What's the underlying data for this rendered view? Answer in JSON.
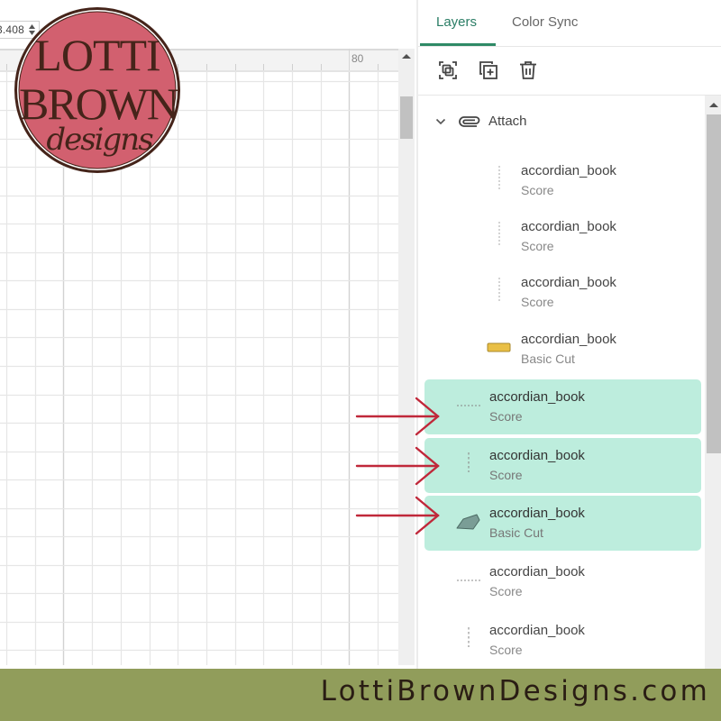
{
  "canvas": {
    "dimension_input": {
      "value": "3.408"
    },
    "ruler": {
      "label": "80"
    }
  },
  "logo": {
    "line1": "LOTTI",
    "line2": "BROWN",
    "script": "designs",
    "colors": {
      "fill": "#d2606f",
      "ink": "#45241a"
    }
  },
  "panel": {
    "tabs": [
      {
        "label": "Layers",
        "active": true
      },
      {
        "label": "Color Sync",
        "active": false
      }
    ],
    "toolbar": [
      {
        "name": "ungroup",
        "icon": "group-select-icon"
      },
      {
        "name": "duplicate",
        "icon": "duplicate-icon"
      },
      {
        "name": "delete",
        "icon": "trash-icon"
      }
    ],
    "group": {
      "label": "Attach",
      "expanded": true,
      "icon": "attach-icon"
    },
    "layers": [
      {
        "name": "accordian_book",
        "type": "Score",
        "icon": "score-vertical-icon",
        "nested": true,
        "selected": false
      },
      {
        "name": "accordian_book",
        "type": "Score",
        "icon": "score-vertical-icon",
        "nested": true,
        "selected": false
      },
      {
        "name": "accordian_book",
        "type": "Score",
        "icon": "score-vertical-icon",
        "nested": true,
        "selected": false
      },
      {
        "name": "accordian_book",
        "type": "Basic Cut",
        "icon": "rectangle-shape-icon",
        "nested": true,
        "selected": false,
        "color": "#e9bf45"
      },
      {
        "name": "accordian_book",
        "type": "Score",
        "icon": "score-horizontal-icon",
        "nested": false,
        "selected": true
      },
      {
        "name": "accordian_book",
        "type": "Score",
        "icon": "score-vertical-icon",
        "nested": false,
        "selected": true
      },
      {
        "name": "accordian_book",
        "type": "Basic Cut",
        "icon": "polygon-shape-icon",
        "nested": false,
        "selected": true,
        "color": "#7a9d96"
      },
      {
        "name": "accordian_book",
        "type": "Score",
        "icon": "score-horizontal-icon",
        "nested": false,
        "selected": false
      },
      {
        "name": "accordian_book",
        "type": "Score",
        "icon": "score-vertical-icon",
        "nested": false,
        "selected": false
      }
    ],
    "accent": "#2f8a66",
    "selected_bg": "#bdeddd"
  },
  "annotations": {
    "arrow_count": 3,
    "arrow_color": "#c0283a"
  },
  "footer": {
    "text": "LottiBrownDesigns.com",
    "bg": "#919d5b"
  }
}
